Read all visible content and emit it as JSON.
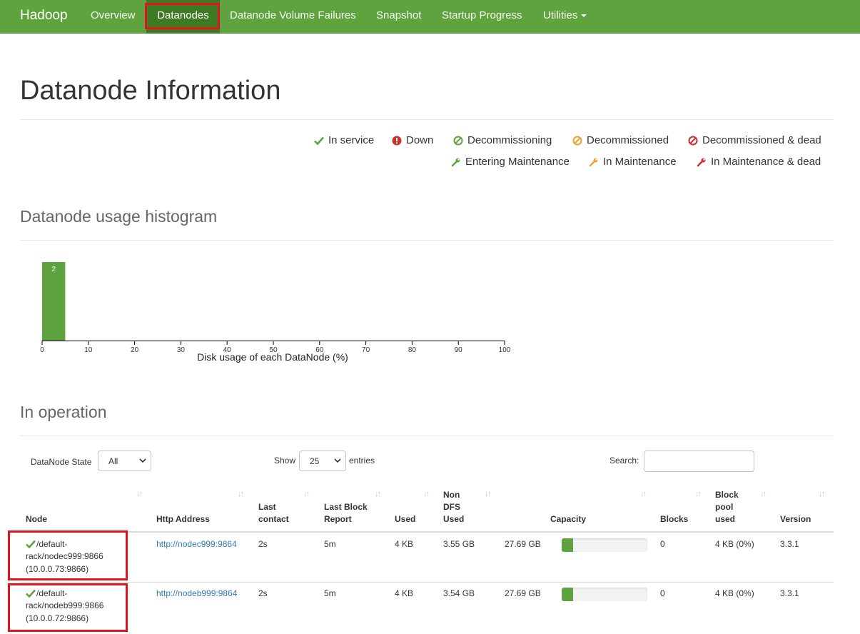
{
  "navbar": {
    "brand": "Hadoop",
    "items": [
      "Overview",
      "Datanodes",
      "Datanode Volume Failures",
      "Snapshot",
      "Startup Progress",
      "Utilities"
    ],
    "active": "Datanodes",
    "colors": {
      "background": "#5fa33e",
      "active": "#3e7a22"
    }
  },
  "page_title": "Datanode Information",
  "legend": {
    "in_service": "In service",
    "down": "Down",
    "decommissioning": "Decommissioning",
    "decommissioned": "Decommissioned",
    "decommissioned_dead": "Decommissioned & dead",
    "entering_maintenance": "Entering Maintenance",
    "in_maintenance": "In Maintenance",
    "in_maintenance_dead": "In Maintenance & dead"
  },
  "histogram": {
    "title": "Datanode usage histogram",
    "chart_data": {
      "type": "bar",
      "xlabel": "Disk usage of each DataNode (%)",
      "xlim": [
        0,
        100
      ],
      "x_ticks": [
        "0",
        "10",
        "20",
        "30",
        "40",
        "50",
        "60",
        "70",
        "80",
        "90",
        "100"
      ],
      "bins": [
        {
          "x0": 0,
          "x1": 5,
          "count": 2
        }
      ],
      "bar_color": "#5fa33e"
    }
  },
  "operation": {
    "title": "In operation",
    "state_label": "DataNode State",
    "state_value": "All",
    "show_label": "Show",
    "show_value": "25",
    "entries_label": "entries",
    "search_label": "Search:",
    "search_value": ""
  },
  "table": {
    "headers": {
      "node": "Node",
      "http": "Http Address",
      "last_contact": [
        "Last",
        "contact"
      ],
      "last_block_report": [
        "Last Block",
        "Report"
      ],
      "used": "Used",
      "non_dfs_used": [
        "Non",
        "DFS",
        "Used"
      ],
      "capacity": "Capacity",
      "blocks": "Blocks",
      "block_pool_used": [
        "Block",
        "pool",
        "used"
      ],
      "version": "Version"
    },
    "rows": [
      {
        "node": [
          "/default-",
          "rack/nodec999:9866",
          "(10.0.0.73:9866)"
        ],
        "http": "http://nodec999:9864",
        "last_contact": "2s",
        "last_block_report": "5m",
        "used": "4 KB",
        "non_dfs_used": "3.55 GB",
        "capacity": "27.69 GB",
        "capacity_used_fraction": 0.13,
        "blocks": "0",
        "block_pool_used": "4 KB (0%)",
        "version": "3.3.1"
      },
      {
        "node": [
          "/default-",
          "rack/nodeb999:9866",
          "(10.0.0.72:9866)"
        ],
        "http": "http://nodeb999:9864",
        "last_contact": "2s",
        "last_block_report": "5m",
        "used": "4 KB",
        "non_dfs_used": "3.54 GB",
        "capacity": "27.69 GB",
        "capacity_used_fraction": 0.13,
        "blocks": "0",
        "block_pool_used": "4 KB (0%)",
        "version": "3.3.1"
      }
    ]
  }
}
